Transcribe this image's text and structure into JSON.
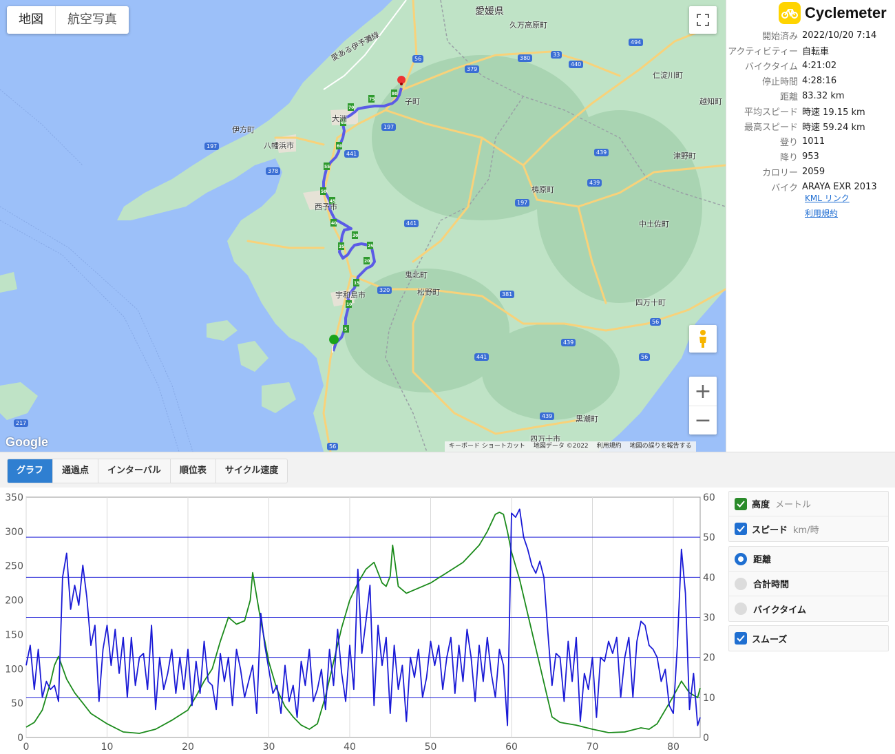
{
  "map": {
    "type_buttons": [
      "地図",
      "航空写真"
    ],
    "place_labels": {
      "ehime": "愛媛県",
      "kumakogen": "久万高原町",
      "niyodogawa": "仁淀川町",
      "ochi": "越知町",
      "ikata": "伊方町",
      "yawatahama": "八幡浜市",
      "ozu": "大洲",
      "uchiko": "子町",
      "seiyo": "西予市",
      "uwajima": "宇和島市",
      "kihoku": "鬼北町",
      "matsuno": "松野町",
      "yusuhara": "梼原町",
      "tsuno": "津野町",
      "nakatosa": "中土佐町",
      "shimanto_town": "四万十町",
      "kuroshio": "黒潮町",
      "shimanto_city": "四万十市",
      "road_name": "愛ある伊予灘線"
    },
    "shields": [
      "56",
      "379",
      "380",
      "33",
      "440",
      "494",
      "197",
      "441",
      "378",
      "197",
      "439",
      "197",
      "439",
      "441",
      "320",
      "381",
      "56",
      "439",
      "441",
      "56",
      "439",
      "217",
      "56"
    ],
    "attribution": [
      "キーボード ショートカット",
      "地図データ ©2022",
      "利用規約",
      "地図の誤りを報告する"
    ],
    "google_logo": "Google"
  },
  "info": {
    "app_name": "Cyclemeter",
    "stats": [
      {
        "k": "開始済み",
        "v": "2022/10/20 7:14"
      },
      {
        "k": "アクティビティー",
        "v": "自転車"
      },
      {
        "k": "バイクタイム",
        "v": "4:21:02"
      },
      {
        "k": "停止時間",
        "v": "4:28:16"
      },
      {
        "k": "距離",
        "v": "83.32 km"
      },
      {
        "k": "平均スピード",
        "v": "時速 19.15 km"
      },
      {
        "k": "最高スピード",
        "v": "時速 59.24 km"
      },
      {
        "k": "登り",
        "v": "1011"
      },
      {
        "k": "降り",
        "v": "953"
      },
      {
        "k": "カロリー",
        "v": "2059"
      },
      {
        "k": "バイク",
        "v": "ARAYA EXR 2013"
      }
    ],
    "kml_link": "KML リンク",
    "terms_link": "利用規約"
  },
  "tabs": [
    "グラフ",
    "通過点",
    "インターバル",
    "順位表",
    "サイクル速度"
  ],
  "controls": {
    "altitude": {
      "label": "高度",
      "unit": "メートル"
    },
    "speed": {
      "label": "スピード",
      "unit": "km/時"
    },
    "x_options": [
      "距離",
      "合計時間",
      "バイクタイム"
    ],
    "smooth": "スムーズ"
  },
  "chart_data": {
    "type": "line",
    "xlim": [
      0,
      83.32
    ],
    "x_ticks": [
      "0",
      "10",
      "20",
      "30",
      "40",
      "50",
      "60",
      "70",
      "80"
    ],
    "y_left": {
      "ticks": [
        "0",
        "50",
        "100",
        "150",
        "200",
        "250",
        "300",
        "350"
      ],
      "lim": [
        0,
        350
      ]
    },
    "y_right": {
      "ticks": [
        "0",
        "10",
        "20",
        "30",
        "40",
        "50",
        "60"
      ],
      "lim": [
        0,
        60
      ]
    },
    "grid": true,
    "series": [
      {
        "name": "高度",
        "axis": "left",
        "color": "#1a8a1a",
        "x": [
          0,
          1,
          2,
          3,
          3.5,
          4,
          5,
          6,
          7,
          8,
          10,
          12,
          14,
          16,
          18,
          20,
          21,
          22,
          23,
          24,
          25,
          26,
          27,
          27.7,
          28,
          28.5,
          29,
          30,
          31,
          32,
          33,
          34,
          35,
          36,
          37,
          38,
          39,
          40,
          41,
          42,
          43,
          44,
          44.5,
          45,
          45.3,
          46,
          47,
          48,
          50,
          52,
          54,
          56,
          57,
          58,
          58.5,
          59,
          59.5,
          60,
          61,
          62,
          63,
          64,
          65,
          66,
          67,
          68,
          70,
          72,
          74,
          76,
          77,
          78,
          79,
          80,
          81,
          82,
          83,
          83.32
        ],
        "values": [
          15,
          22,
          40,
          80,
          105,
          118,
          85,
          65,
          50,
          35,
          20,
          8,
          6,
          12,
          25,
          40,
          60,
          82,
          100,
          140,
          175,
          165,
          170,
          200,
          240,
          205,
          170,
          110,
          70,
          45,
          30,
          18,
          12,
          20,
          60,
          110,
          160,
          200,
          225,
          245,
          255,
          225,
          220,
          235,
          280,
          220,
          210,
          215,
          225,
          240,
          255,
          280,
          300,
          325,
          328,
          325,
          300,
          270,
          230,
          180,
          130,
          80,
          30,
          22,
          20,
          18,
          12,
          7,
          8,
          14,
          12,
          20,
          40,
          60,
          82,
          65,
          58,
          72
        ]
      },
      {
        "name": "スピード",
        "axis": "right",
        "color": "#1a1ad6",
        "x": [
          0,
          0.5,
          1,
          1.5,
          2,
          2.5,
          3,
          3.5,
          4,
          4.5,
          5,
          5.5,
          6,
          6.5,
          7,
          7.5,
          8,
          8.5,
          9,
          9.5,
          10,
          10.5,
          11,
          11.5,
          12,
          12.5,
          13,
          13.5,
          14,
          14.5,
          15,
          15.5,
          16,
          16.5,
          17,
          17.5,
          18,
          18.5,
          19,
          19.5,
          20,
          20.5,
          21,
          21.5,
          22,
          22.5,
          23,
          23.5,
          24,
          24.5,
          25,
          25.5,
          26,
          26.5,
          27,
          27.5,
          28,
          28.5,
          29,
          29.5,
          30,
          30.5,
          31,
          31.5,
          32,
          32.5,
          33,
          33.5,
          34,
          34.5,
          35,
          35.5,
          36,
          36.5,
          37,
          37.5,
          38,
          38.5,
          39,
          39.5,
          40,
          40.5,
          41,
          41.5,
          42,
          42.5,
          43,
          43.5,
          44,
          44.5,
          45,
          45.5,
          46,
          46.5,
          47,
          47.5,
          48,
          48.5,
          49,
          49.5,
          50,
          50.5,
          51,
          51.5,
          52,
          52.5,
          53,
          53.5,
          54,
          54.5,
          55,
          55.5,
          56,
          56.5,
          57,
          57.5,
          58,
          58.5,
          59,
          59.5,
          60,
          60.5,
          61,
          61.5,
          62,
          62.5,
          63,
          63.5,
          64,
          64.5,
          65,
          65.5,
          66,
          66.5,
          67,
          67.5,
          68,
          68.5,
          69,
          69.5,
          70,
          70.5,
          71,
          71.5,
          72,
          72.5,
          73,
          73.5,
          74,
          74.5,
          75,
          75.5,
          76,
          76.5,
          77,
          77.5,
          78,
          78.5,
          79,
          79.5,
          80,
          80.5,
          81,
          81.5,
          82,
          82.5,
          83,
          83.32
        ],
        "values": [
          18,
          23,
          12,
          22,
          10,
          14,
          12,
          13,
          9,
          40,
          46,
          32,
          38,
          33,
          43,
          35,
          23,
          28,
          9,
          22,
          28,
          18,
          27,
          16,
          25,
          10,
          25,
          13,
          20,
          21,
          12,
          28,
          7,
          20,
          12,
          16,
          22,
          11,
          20,
          12,
          22,
          8,
          19,
          11,
          24,
          14,
          13,
          7,
          21,
          14,
          20,
          8,
          22,
          17,
          10,
          14,
          18,
          6,
          31,
          23,
          17,
          11,
          13,
          6,
          18,
          9,
          13,
          5,
          19,
          13,
          22,
          9,
          12,
          17,
          7,
          22,
          13,
          27,
          16,
          9,
          23,
          12,
          42,
          21,
          29,
          38,
          8,
          28,
          18,
          25,
          6,
          23,
          12,
          18,
          4,
          20,
          15,
          22,
          10,
          15,
          24,
          18,
          23,
          12,
          20,
          25,
          11,
          23,
          14,
          27,
          20,
          9,
          23,
          14,
          25,
          16,
          10,
          22,
          18,
          3,
          56,
          55,
          57,
          50,
          47,
          43,
          41,
          44,
          40,
          26,
          13,
          21,
          20,
          9,
          24,
          14,
          25,
          4,
          16,
          12,
          20,
          5,
          20,
          19,
          24,
          21,
          25,
          10,
          20,
          25,
          10,
          24,
          29,
          28,
          23,
          22,
          20,
          14,
          17,
          8,
          6,
          23,
          47,
          36,
          7,
          16,
          3,
          5
        ]
      }
    ]
  }
}
